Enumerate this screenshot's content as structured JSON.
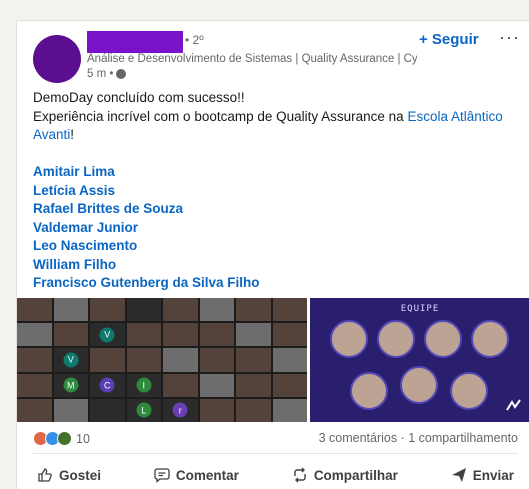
{
  "post": {
    "author": {
      "degree": "• 2º",
      "headline": "Análise e Desenvolvimento de Sistemas | Quality Assurance | Cy...",
      "time": "5 m •"
    },
    "follow_label": "+ Seguir",
    "more_label": "···",
    "text_line1": "DemoDay concluído com sucesso!!",
    "text_line2_prefix": "Experiência incrível com o bootcamp de Quality Assurance na ",
    "text_line2_link": "Escola Atlântico Avanti",
    "text_line2_suffix": "!",
    "mentions": [
      "Amitair Lima",
      "Letícia Assis",
      "Rafael Brittes de Souza",
      "Valdemar Junior",
      "Leo Nascimento",
      "William Filho",
      "Francisco Gutenberg da Silva Filho"
    ],
    "media": {
      "team_title": "EQUIPE",
      "grid_initials": [
        "V",
        "V",
        "M",
        "C",
        "I",
        "L",
        "r"
      ]
    },
    "reaction_count": "10",
    "stats_right": "3 comentários · 1 compartilhamento",
    "actions": {
      "like": "Gostei",
      "comment": "Comentar",
      "share": "Compartilhar",
      "send": "Enviar"
    }
  },
  "colors": {
    "link": "#0a66c2",
    "avatar": "#5b0e8f",
    "name_redaction": "#7a12c9",
    "team_background": "#2a1e6e"
  }
}
